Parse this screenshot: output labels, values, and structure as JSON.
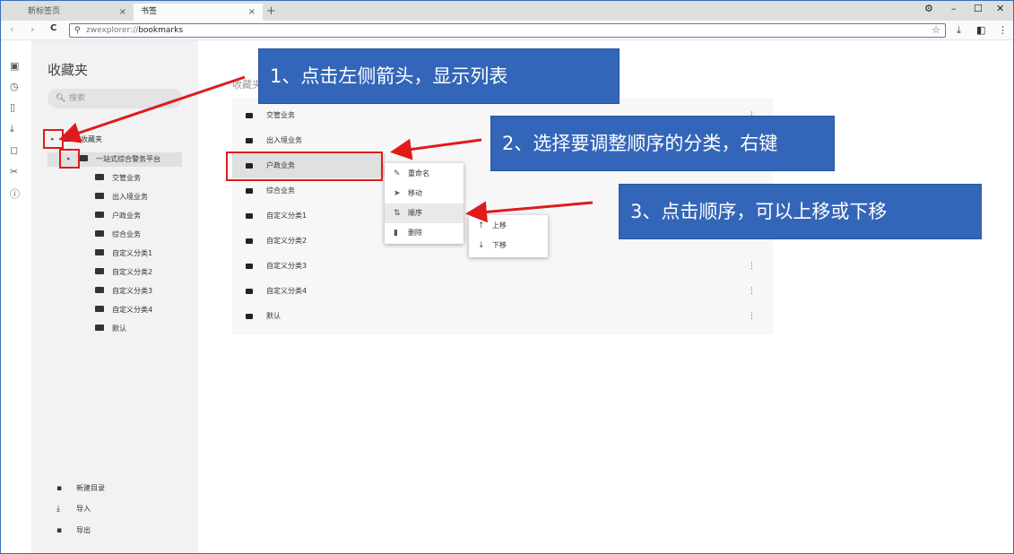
{
  "browser": {
    "tabs": [
      {
        "label": "新标签页",
        "close": "×"
      },
      {
        "label": "书签",
        "close": "×"
      }
    ],
    "new_tab": "+",
    "window_controls": {
      "settings": "⚙",
      "minimize": "–",
      "maximize": "☐",
      "close": "✕"
    },
    "nav": {
      "back": "‹",
      "forward": "›",
      "reload": "C"
    },
    "address": {
      "scheme": "zwexplorer://",
      "path": "bookmarks",
      "search_icon": "⚲",
      "star": "☆"
    },
    "toolbar": {
      "download": "⤓",
      "panel": "◧",
      "menu": "⋮"
    }
  },
  "rail": {
    "icons": [
      {
        "name": "tabs-icon",
        "glyph": "▣"
      },
      {
        "name": "history-icon",
        "glyph": "◷"
      },
      {
        "name": "pages-icon",
        "glyph": "▯"
      },
      {
        "name": "download-icon",
        "glyph": "⤓"
      },
      {
        "name": "bookmark-icon",
        "glyph": "◻"
      },
      {
        "name": "tools-icon",
        "glyph": "✂"
      },
      {
        "name": "info-icon",
        "glyph": "ⓘ"
      }
    ]
  },
  "sidebar": {
    "title": "收藏夹",
    "search_placeholder": "搜索",
    "root_label": "收藏夹",
    "platform_label": "一站式综合警务平台",
    "children": [
      "交管业务",
      "出入境业务",
      "户政业务",
      "综合业务",
      "自定义分类1",
      "自定义分类2",
      "自定义分类3",
      "自定义分类4",
      "默认"
    ],
    "bottom": [
      {
        "icon": "▪",
        "label": "新建目录"
      },
      {
        "icon": "⤓",
        "label": "导入"
      },
      {
        "icon": "▪",
        "label": "导出"
      }
    ]
  },
  "main": {
    "breadcrumb": "收藏夹",
    "rows": [
      "交管业务",
      "出入境业务",
      "户政业务",
      "综合业务",
      "自定义分类1",
      "自定义分类2",
      "自定义分类3",
      "自定义分类4",
      "默认"
    ],
    "more_glyph": "⋮"
  },
  "context_menu": {
    "items": [
      {
        "icon": "✎",
        "label": "重命名"
      },
      {
        "icon": "➤",
        "label": "移动"
      },
      {
        "icon": "⇅",
        "label": "顺序"
      },
      {
        "icon": "▮",
        "label": "删除"
      }
    ]
  },
  "submenu": {
    "items": [
      {
        "icon": "↑",
        "label": "上移"
      },
      {
        "icon": "↓",
        "label": "下移"
      }
    ]
  },
  "annotations": {
    "step1": "1、点击左侧箭头，显示列表",
    "step2": "2、选择要调整顺序的分类，右键",
    "step3": "3、点击顺序，可以上移或下移",
    "accent_color": "#3366b8",
    "highlight_color": "#e01b1b"
  }
}
